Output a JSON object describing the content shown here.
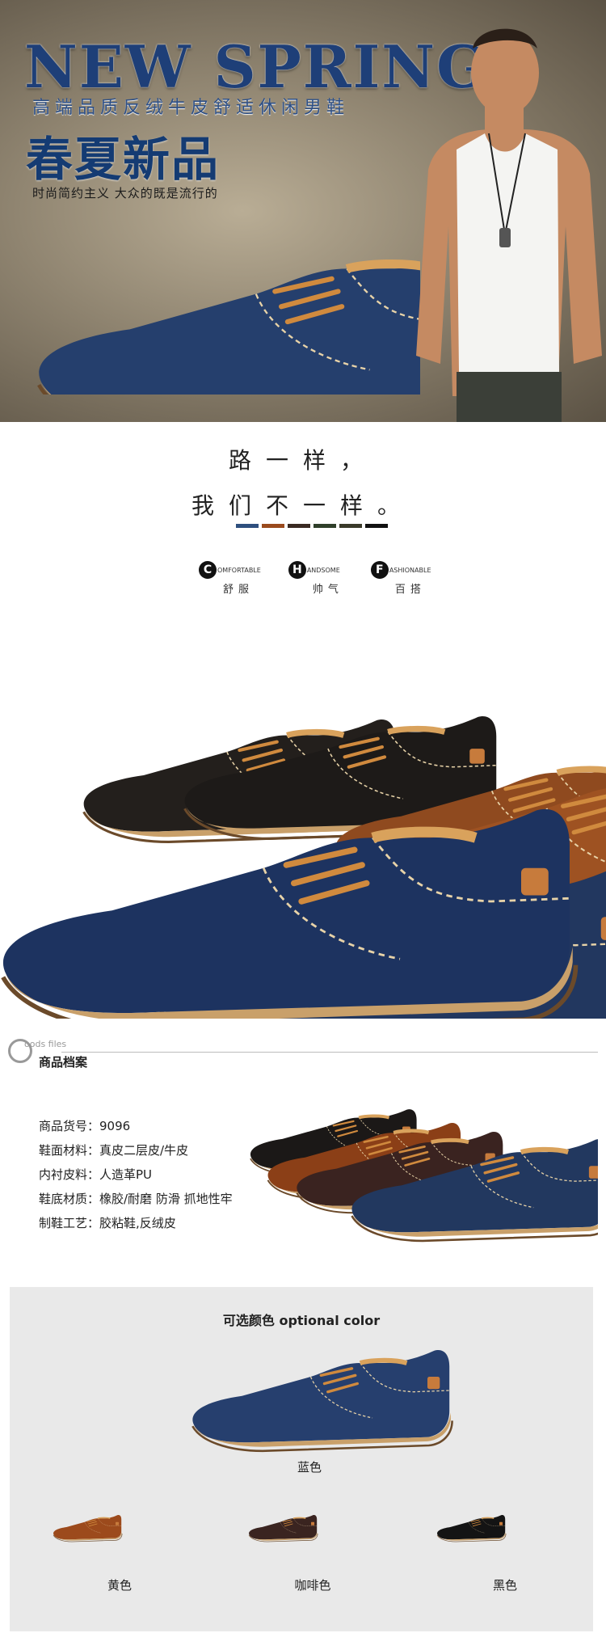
{
  "hero": {
    "title": "NEW SPRING",
    "subtitle": "高端品质反绒牛皮舒适休闲男鞋",
    "cn_title": "春夏新品",
    "tagline": "时尚简约主义  大众的既是流行的"
  },
  "slogan": {
    "line1": "路一样，",
    "line2": "我们不一样。",
    "swatch_colors": [
      "#2e4f7e",
      "#9a4a1d",
      "#3a2a22",
      "#2f3f2a",
      "#3a3a2a",
      "#111111"
    ]
  },
  "features": [
    {
      "letter": "C",
      "word": "OMFORTABLE",
      "cn": "舒服"
    },
    {
      "letter": "H",
      "word": "ANDSOME",
      "cn": "帅气"
    },
    {
      "letter": "F",
      "word": "ASHIONABLE",
      "cn": "百搭"
    }
  ],
  "section": {
    "g_letter": "G",
    "g_text": "oods files",
    "title": "商品档案"
  },
  "specs": [
    "商品货号：9096",
    "鞋面材料：真皮二层皮/牛皮",
    "内衬皮料：人造革PU",
    "鞋底材质：橡胶/耐磨 防滑 抓地性牢",
    "制鞋工艺：胶粘鞋,反绒皮"
  ],
  "colors": {
    "title": "可选颜色 optional color",
    "items": [
      {
        "label": "蓝色",
        "color": "#263f6e"
      },
      {
        "label": "黄色",
        "color": "#9c4a1c"
      },
      {
        "label": "咖啡色",
        "color": "#3a2420"
      },
      {
        "label": "黑色",
        "color": "#141414"
      }
    ]
  },
  "icons": {
    "shoe": "shoe-icon"
  }
}
